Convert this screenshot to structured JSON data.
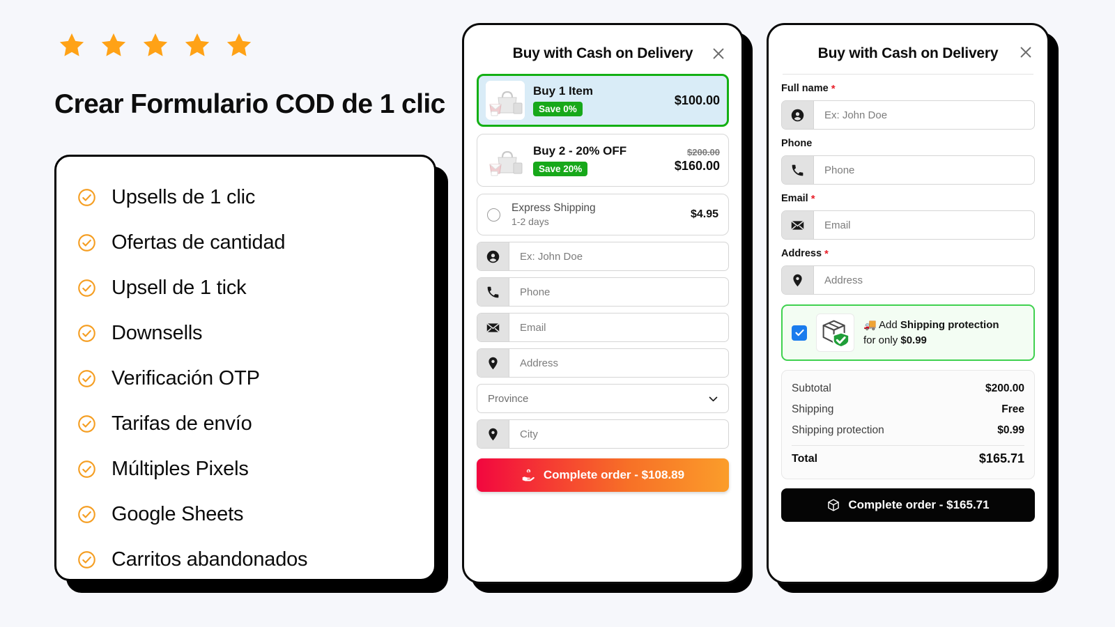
{
  "left": {
    "rating_stars": 5,
    "star_color": "#ffa216",
    "headline": "Crear Formulario COD de 1 clic",
    "features": [
      {
        "icon": "check-circle-icon",
        "label": "Upsells de 1 clic"
      },
      {
        "icon": "check-circle-icon",
        "label": "Ofertas de cantidad"
      },
      {
        "icon": "check-circle-icon",
        "label": "Upsell de 1 tick"
      },
      {
        "icon": "check-circle-icon",
        "label": "Downsells"
      },
      {
        "icon": "check-circle-icon",
        "label": "Verificación OTP"
      },
      {
        "icon": "check-circle-icon",
        "label": "Tarifas de envío"
      },
      {
        "icon": "check-circle-icon",
        "label": "Múltiples Pixels"
      },
      {
        "icon": "check-circle-icon",
        "label": "Google Sheets"
      },
      {
        "icon": "check-circle-icon",
        "label": "Carritos abandonados"
      }
    ]
  },
  "middle_card": {
    "title": "Buy with Cash on Delivery",
    "close_icon": "close-icon",
    "offers": [
      {
        "title": "Buy 1 Item",
        "badge": "Save 0%",
        "price": "$100.00",
        "old_price": "",
        "selected": true,
        "thumb_icon": "handbag-product-image"
      },
      {
        "title": "Buy 2 - 20% OFF",
        "badge": "Save 20%",
        "price": "$160.00",
        "old_price": "$200.00",
        "selected": false,
        "thumb_icon": "handbag-product-image"
      }
    ],
    "shipping_option": {
      "name": "Express Shipping",
      "eta": "1-2 days",
      "price": "$4.95",
      "selected": false
    },
    "fields": [
      {
        "icon": "person-circle-icon",
        "placeholder": "Ex: John Doe"
      },
      {
        "icon": "phone-icon",
        "placeholder": "Phone"
      },
      {
        "icon": "envelope-icon",
        "placeholder": "Email"
      },
      {
        "icon": "location-pin-icon",
        "placeholder": "Address"
      }
    ],
    "province_select": {
      "value": "Province",
      "icon": "chevron-down-icon"
    },
    "city_field": {
      "icon": "location-pin-icon",
      "placeholder": "City"
    },
    "cta": {
      "label": "Complete order - $108.89",
      "icon": "hand-holding-dollar-icon"
    }
  },
  "right_card": {
    "title": "Buy with Cash on Delivery",
    "close_icon": "close-icon",
    "fields": [
      {
        "label": "Full name",
        "required": true,
        "icon": "person-circle-icon",
        "placeholder": "Ex: John Doe"
      },
      {
        "label": "Phone",
        "required": false,
        "icon": "phone-icon",
        "placeholder": "Phone"
      },
      {
        "label": "Email",
        "required": true,
        "icon": "envelope-icon",
        "placeholder": "Email"
      },
      {
        "label": "Address",
        "required": true,
        "icon": "location-pin-icon",
        "placeholder": "Address"
      }
    ],
    "protection": {
      "checked": true,
      "icon": "package-shield-icon",
      "emoji": "🚚",
      "text_before": "Add ",
      "text_bold": "Shipping protection",
      "text_line2_before": "for only ",
      "text_line2_bold": "$0.99"
    },
    "summary": {
      "rows": [
        {
          "key": "Subtotal",
          "value": "$200.00"
        },
        {
          "key": "Shipping",
          "value": "Free"
        },
        {
          "key": "Shipping protection",
          "value": "$0.99"
        }
      ],
      "total": {
        "key": "Total",
        "value": "$165.71"
      }
    },
    "cta": {
      "label": "Complete order - $165.71",
      "icon": "box-3d-icon"
    }
  }
}
